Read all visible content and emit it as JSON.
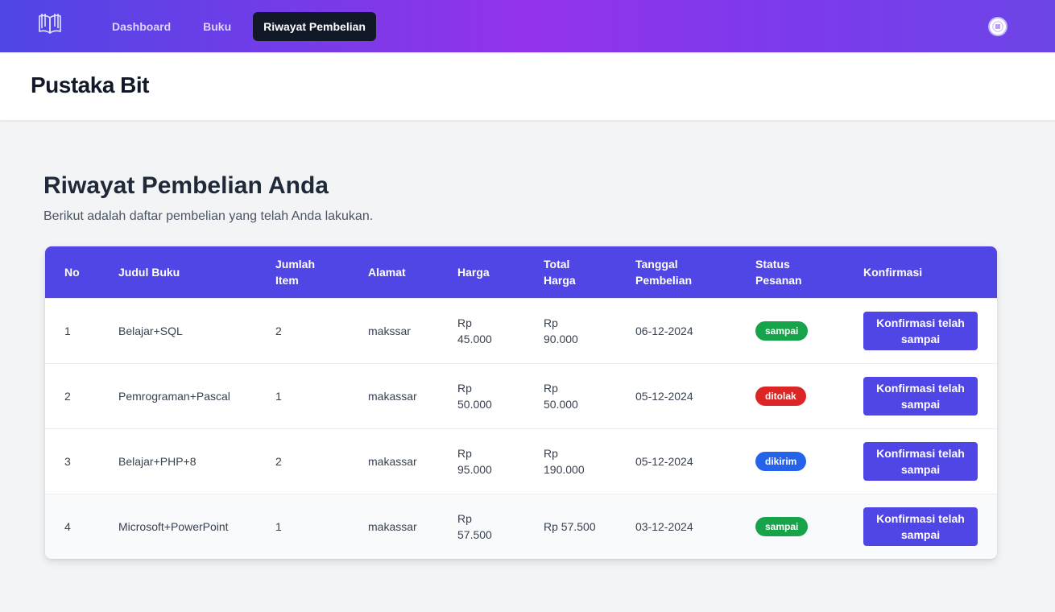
{
  "nav": {
    "items": [
      {
        "label": "Dashboard",
        "active": false
      },
      {
        "label": "Buku",
        "active": false
      },
      {
        "label": "Riwayat Pembelian",
        "active": true
      }
    ]
  },
  "header": {
    "brand": "Pustaka Bit"
  },
  "page": {
    "title": "Riwayat Pembelian Anda",
    "subtitle": "Berikut adalah daftar pembelian yang telah Anda lakukan."
  },
  "table": {
    "columns": [
      "No",
      "Judul Buku",
      "Jumlah Item",
      "Alamat",
      "Harga",
      "Total Harga",
      "Tanggal Pembelian",
      "Status Pesanan",
      "Konfirmasi"
    ],
    "rows": [
      {
        "no": "1",
        "judul": "Belajar+SQL",
        "jumlah": "2",
        "alamat": "makssar",
        "harga": "Rp 45.000",
        "total": "Rp 90.000",
        "tanggal": "06-12-2024",
        "status": "sampai",
        "status_color": "#16a34a",
        "action": "Konfirmasi telah sampai"
      },
      {
        "no": "2",
        "judul": "Pemrograman+Pascal",
        "jumlah": "1",
        "alamat": "makassar",
        "harga": "Rp 50.000",
        "total": "Rp 50.000",
        "tanggal": "05-12-2024",
        "status": "ditolak",
        "status_color": "#dc2626",
        "action": "Konfirmasi telah sampai"
      },
      {
        "no": "3",
        "judul": "Belajar+PHP+8",
        "jumlah": "2",
        "alamat": "makassar",
        "harga": "Rp 95.000",
        "total": "Rp 190.000",
        "tanggal": "05-12-2024",
        "status": "dikirim",
        "status_color": "#2563eb",
        "action": "Konfirmasi telah sampai"
      },
      {
        "no": "4",
        "judul": "Microsoft+PowerPoint",
        "jumlah": "1",
        "alamat": "makassar",
        "harga": "Rp 57.500",
        "total": "Rp 57.500",
        "tanggal": "03-12-2024",
        "status": "sampai",
        "status_color": "#16a34a",
        "action": "Konfirmasi telah sampai"
      }
    ]
  },
  "colors": {
    "accent": "#5046e5",
    "nav_gradient_start": "#4f46e5",
    "nav_gradient_mid": "#9333ea"
  },
  "icons": {
    "logo": "open-book-icon",
    "user_menu": "menu-icon"
  }
}
